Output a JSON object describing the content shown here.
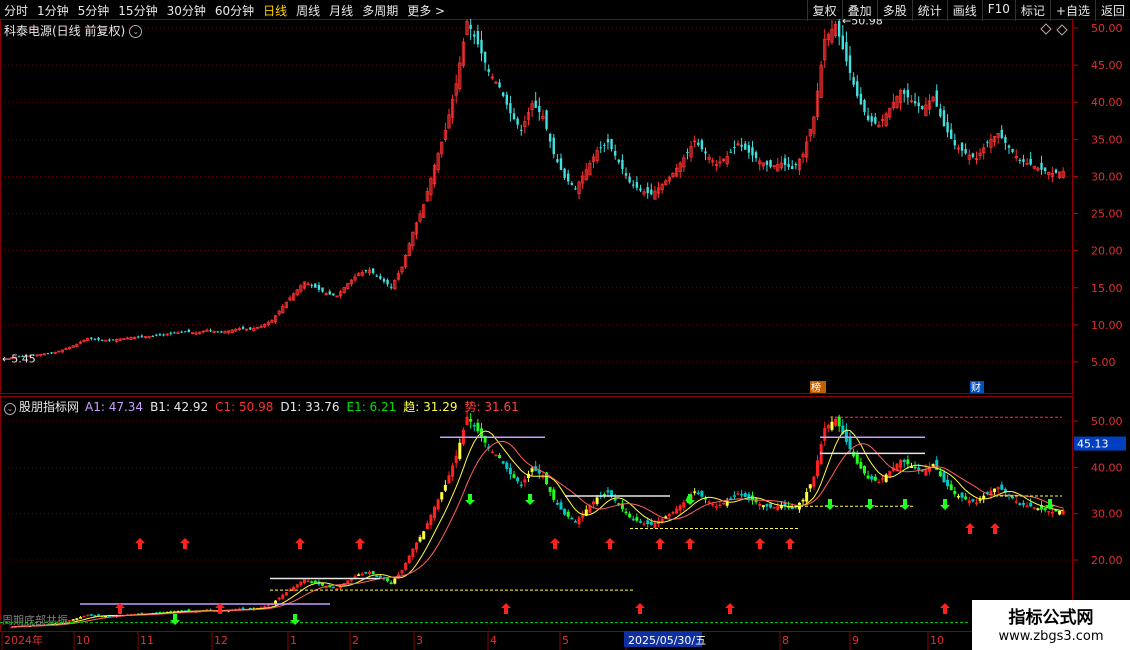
{
  "toolbar": {
    "periods": [
      "分时",
      "1分钟",
      "5分钟",
      "15分钟",
      "30分钟",
      "60分钟",
      "日线",
      "周线",
      "月线",
      "多周期",
      "更多 >"
    ],
    "active_index": 6,
    "right_buttons": [
      "复权",
      "叠加",
      "多股",
      "统计",
      "画线",
      "F10",
      "标记",
      "+自选",
      "返回"
    ]
  },
  "main_chart": {
    "title": "科泰电源(日线 前复权)",
    "high_label": "50.98",
    "low_label": "5.45",
    "yaxis": [
      "50.00",
      "45.00",
      "40.00",
      "35.00",
      "30.00",
      "25.00",
      "20.00",
      "15.00",
      "10.00",
      "5.00"
    ],
    "markers": [
      "榜",
      "财"
    ]
  },
  "indicator": {
    "name": "股朋指标网",
    "values": [
      {
        "label": "A1: 47.34",
        "color": "#c9a0ff"
      },
      {
        "label": "B1: 42.92",
        "color": "#e8e8e8"
      },
      {
        "label": "C1: 50.98",
        "color": "#ff3030"
      },
      {
        "label": "D1: 33.76",
        "color": "#e8e8e8"
      },
      {
        "label": "E1: 6.21",
        "color": "#00e000"
      },
      {
        "label": "趋: 31.29",
        "color": "#ffff40"
      },
      {
        "label": "势: 31.61",
        "color": "#ff4040"
      }
    ],
    "yaxis": [
      "50.00",
      "40.00",
      "30.00",
      "20.00"
    ],
    "current_price": "45.13",
    "bottom_text": "周期底部共振"
  },
  "xaxis": {
    "labels": [
      "2024年",
      "10",
      "11",
      "12",
      "1",
      "2",
      "3",
      "4",
      "5",
      "2025/05/30/五",
      "8",
      "9",
      "10"
    ]
  },
  "watermark": {
    "line1": "指标公式网",
    "line2": "www.zbgs3.com"
  },
  "chart_data": {
    "type": "candlestick",
    "ylim": [
      5,
      52
    ],
    "max": 50.98,
    "min": 5.45,
    "close_series": [
      5.6,
      5.8,
      5.9,
      6.1,
      6.3,
      6.8,
      7.4,
      8.2,
      8.0,
      7.9,
      8.1,
      8.3,
      8.4,
      8.5,
      8.7,
      8.9,
      9.1,
      8.9,
      9.3,
      9.0,
      9.2,
      9.5,
      9.4,
      9.8,
      10.6,
      12.5,
      14.2,
      15.8,
      15.0,
      14.2,
      13.9,
      15.6,
      16.9,
      17.4,
      16.2,
      15.1,
      17.8,
      22.5,
      26.2,
      31.5,
      36.2,
      42.5,
      50.9,
      47.8,
      44.1,
      42.0,
      38.5,
      36.2,
      39.8,
      38.1,
      33.0,
      29.8,
      28.4,
      30.9,
      33.5,
      34.6,
      31.9,
      29.2,
      28.1,
      27.6,
      28.9,
      30.4,
      32.5,
      34.8,
      33.1,
      31.6,
      32.7,
      34.4,
      33.2,
      32.1,
      31.3,
      31.8,
      31.0,
      33.0,
      38.0,
      48.5,
      50.5,
      45.5,
      40.8,
      37.6,
      36.9,
      39.2,
      41.6,
      40.2,
      39.1,
      40.7,
      36.8,
      34.2,
      33.1,
      32.4,
      34.6,
      35.8,
      33.9,
      32.1,
      31.6,
      30.9,
      30.4,
      30.7
    ]
  }
}
